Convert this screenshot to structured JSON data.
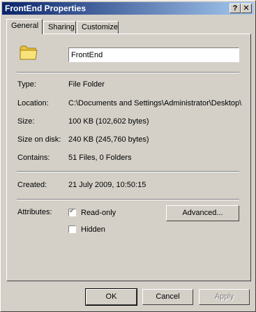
{
  "window": {
    "title": "FrontEnd Properties",
    "help_label": "?",
    "close_label": "✕"
  },
  "tabs": [
    {
      "label": "General",
      "active": true
    },
    {
      "label": "Sharing",
      "active": false
    },
    {
      "label": "Customize",
      "active": false
    }
  ],
  "general": {
    "icon": "folder-icon",
    "name_value": "FrontEnd",
    "fields": {
      "type": {
        "label": "Type:",
        "value": "File Folder"
      },
      "location": {
        "label": "Location:",
        "value": "C:\\Documents and Settings\\Administrator\\Desktop\\"
      },
      "size": {
        "label": "Size:",
        "value": "100 KB (102,602 bytes)"
      },
      "size_on_disk": {
        "label": "Size on disk:",
        "value": "240 KB (245,760 bytes)"
      },
      "contains": {
        "label": "Contains:",
        "value": "51 Files, 0 Folders"
      },
      "created": {
        "label": "Created:",
        "value": "21 July 2009, 10:50:15"
      }
    },
    "attributes": {
      "label": "Attributes:",
      "read_only": {
        "label": "Read-only",
        "checked": true
      },
      "hidden": {
        "label": "Hidden",
        "checked": false
      },
      "advanced_label": "Advanced..."
    }
  },
  "footer": {
    "ok_label": "OK",
    "cancel_label": "Cancel",
    "apply_label": "Apply"
  }
}
